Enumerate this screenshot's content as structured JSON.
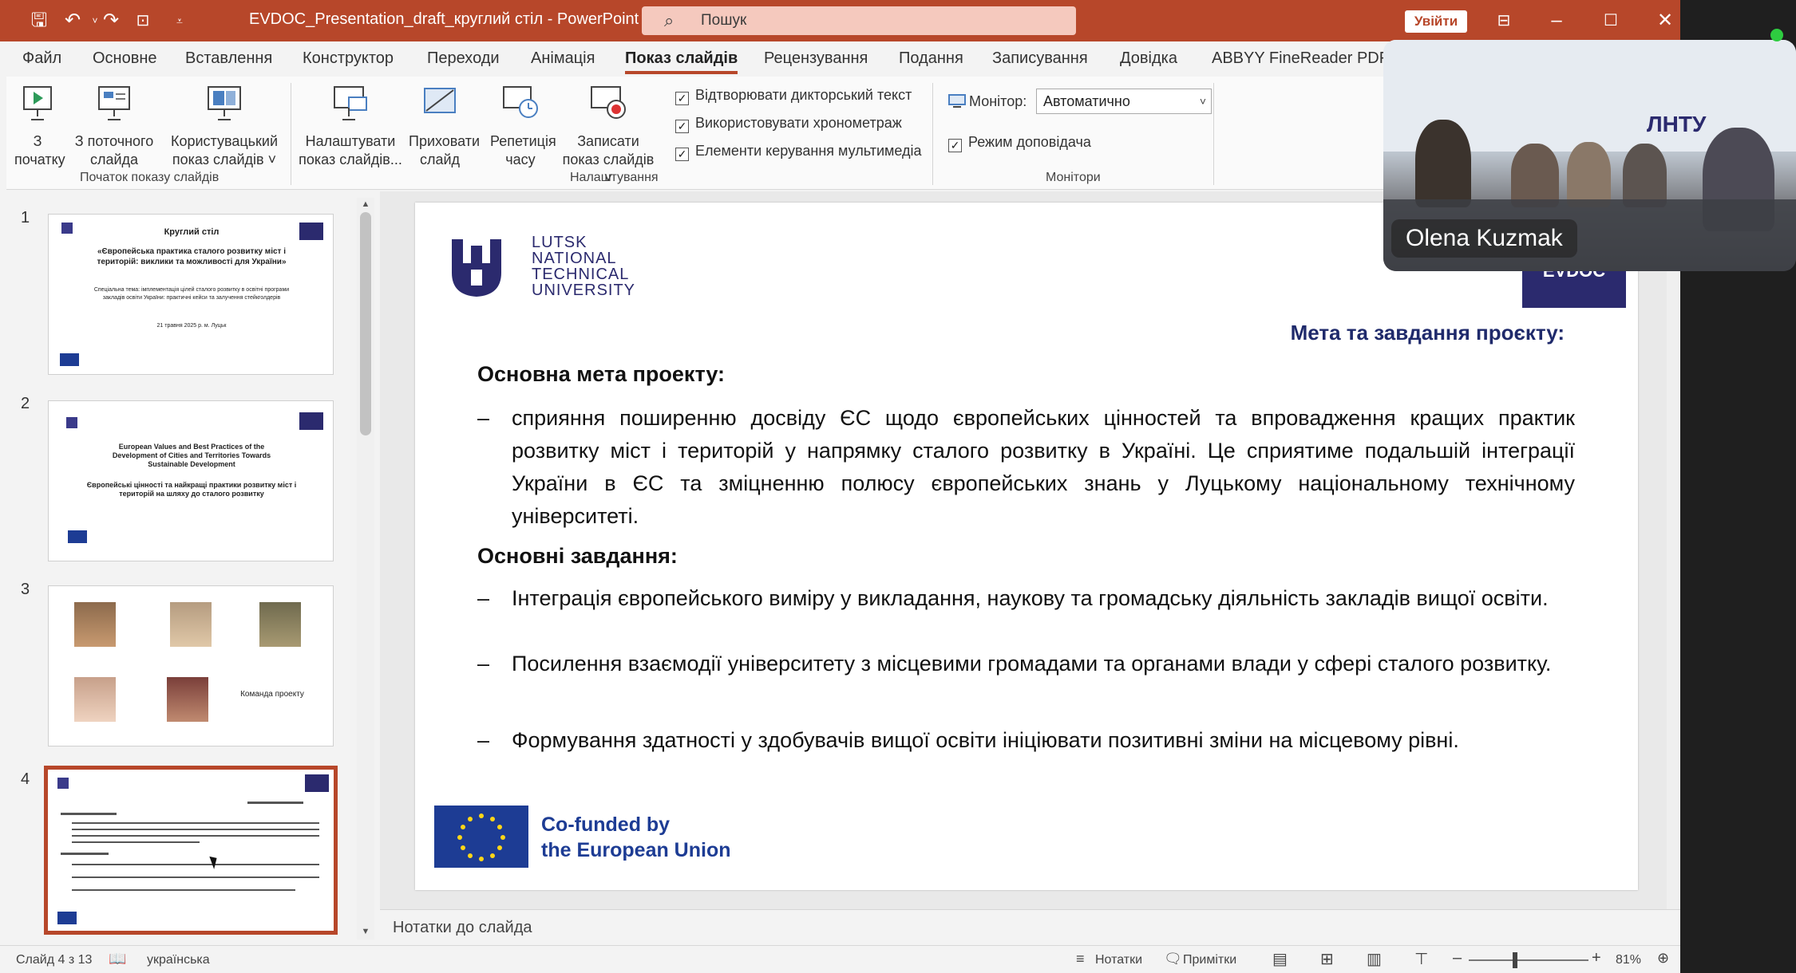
{
  "window": {
    "title": "EVDOC_Presentation_draft_круглий стіл  -  PowerPoint",
    "search_placeholder": "Пошук",
    "signin_label": "Увійти"
  },
  "ribbon": {
    "tabs": [
      "Файл",
      "Основне",
      "Вставлення",
      "Конструктор",
      "Переходи",
      "Анімація",
      "Показ слайдів",
      "Рецензування",
      "Подання",
      "Записування",
      "Довідка",
      "ABBYY FineReader PDF"
    ],
    "active_tab": "Показ слайдів",
    "groups": {
      "start": {
        "label": "Початок показу слайдів",
        "buttons": [
          "З початку",
          "З поточного слайда",
          "Користувацький показ слайдів ˅"
        ]
      },
      "setup": {
        "label": "Налаштування",
        "buttons": [
          "Налаштувати показ слайдів...",
          "Приховати слайд",
          "Репетиція часу",
          "Записати показ слайдів ˅"
        ],
        "checks": [
          "Відтворювати дикторський текст",
          "Використовувати хронометраж",
          "Елементи керування мультимедіа"
        ]
      },
      "monitors": {
        "label": "Монітори",
        "monitor_label": "Монітор:",
        "monitor_value": "Автоматично",
        "presenter_view": "Режим доповідача"
      }
    }
  },
  "thumbnails": {
    "numbers": [
      "1",
      "2",
      "3",
      "4"
    ],
    "slide1": {
      "title": "Круглий стіл",
      "subtitle": "«Європейська практика сталого розвитку міст і територій: виклики та можливості для України»",
      "theme": "Спеціальна тема: імплементація цілей сталого розвитку в освітні програми закладів освіти України: практичні кейси та залучення стейкголдерів",
      "date": "21 травня 2025 р. м. Луцьк"
    },
    "slide2": {
      "title_en": "European Values and Best Practices of the Development of Cities and Territories Towards Sustainable Development",
      "title_uk": "Європейські цінності та найкращі практики розвитку міст і територій на шляху до сталого розвитку"
    },
    "slide3": {
      "team_label": "Команда проекту"
    }
  },
  "slide": {
    "university": [
      "LUTSK",
      "NATIONAL",
      "TECHNICAL",
      "UNIVERSITY"
    ],
    "badge": "EVDOC",
    "heading": "Мета та завдання проєкту:",
    "goal_title": "Основна мета проекту:",
    "goal_items": [
      "сприяння поширенню досвіду ЄС щодо європейських цінностей та впровадження кращих практик розвитку міст і територій у напрямку сталого розвитку в Україні. Це сприятиме подальшій інтеграції України в ЄС та зміцненню полюсу європейських знань у Луцькому національному технічному університеті."
    ],
    "tasks_title": "Основні завдання:",
    "task_items": [
      "Інтеграція європейського виміру у викладання, наукову та громадську діяльність закладів вищої освіти.",
      "Посилення взаємодії університету з місцевими громадами та органами влади у сфері сталого розвитку.",
      "Формування здатності у здобувачів вищої освіти ініціювати позитивні зміни на місцевому рівні."
    ],
    "eu_line1": "Co-funded by",
    "eu_line2": "the European Union"
  },
  "notes_placeholder": "Нотатки до слайда",
  "status": {
    "slide_info": "Слайд 4 з 13",
    "language": "українська",
    "notes": "Нотатки",
    "comments": "Примітки",
    "zoom": "81%"
  },
  "video": {
    "participant_name": "Olena Kuzmak",
    "wall_sign": "ЛНТУ"
  },
  "colors": {
    "titlebar": "#b7472a",
    "brand_navy": "#2b2a6e",
    "eu_blue": "#1d3c94"
  }
}
